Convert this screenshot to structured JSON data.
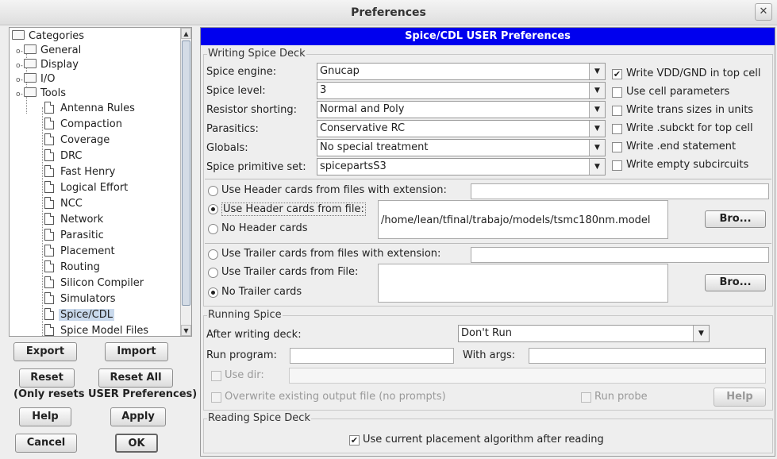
{
  "window": {
    "title": "Preferences",
    "close": "✕"
  },
  "tree": {
    "root": "Categories",
    "groups": [
      {
        "label": "General"
      },
      {
        "label": "Display"
      },
      {
        "label": "I/O"
      },
      {
        "label": "Tools"
      }
    ],
    "items": [
      "Antenna Rules",
      "Compaction",
      "Coverage",
      "DRC",
      "Fast Henry",
      "Logical Effort",
      "NCC",
      "Network",
      "Parasitic",
      "Placement",
      "Routing",
      "Silicon Compiler",
      "Simulators",
      "Spice/CDL",
      "Spice Model Files"
    ],
    "selected": "Spice/CDL"
  },
  "left_buttons": {
    "export": "Export",
    "import": "Import",
    "reset": "Reset",
    "reset_all": "Reset All",
    "reset_note": "(Only resets USER Preferences)",
    "help": "Help",
    "apply": "Apply",
    "cancel": "Cancel",
    "ok": "OK"
  },
  "panel": {
    "title": "Spice/CDL USER Preferences",
    "writing": {
      "title": "Writing Spice Deck",
      "engine_label": "Spice engine:",
      "engine_value": "Gnucap",
      "level_label": "Spice level:",
      "level_value": "3",
      "resistor_label": "Resistor shorting:",
      "resistor_value": "Normal and Poly",
      "parasitics_label": "Parasitics:",
      "parasitics_value": "Conservative RC",
      "globals_label": "Globals:",
      "globals_value": "No special treatment",
      "primitive_label": "Spice primitive set:",
      "primitive_value": "spicepartsS3",
      "checks": [
        {
          "label": "Write VDD/GND in top cell",
          "checked": true
        },
        {
          "label": "Use cell parameters",
          "checked": false
        },
        {
          "label": "Write trans sizes in units",
          "checked": false
        },
        {
          "label": "Write .subckt for top cell",
          "checked": false
        },
        {
          "label": "Write .end statement",
          "checked": false
        },
        {
          "label": "Write empty subcircuits",
          "checked": false
        }
      ],
      "header_ext_label": "Use Header cards from files with extension:",
      "header_file_label": "Use Header cards from file:",
      "header_file_value": "/home/lean/tfinal/trabajo/models/tsmc180nm.model",
      "no_header_label": "No Header cards",
      "browse1": "Bro...",
      "trailer_ext_label": "Use Trailer cards from files with extension:",
      "trailer_file_label": "Use Trailer cards from File:",
      "no_trailer_label": "No Trailer cards",
      "browse2": "Bro..."
    },
    "running": {
      "title": "Running Spice",
      "after_label": "After writing deck:",
      "after_value": "Don't Run",
      "run_program_label": "Run program:",
      "with_args_label": "With args:",
      "use_dir_label": "Use dir:",
      "overwrite_label": "Overwrite existing output file (no prompts)",
      "run_probe_label": "Run probe",
      "help": "Help"
    },
    "reading": {
      "title": "Reading Spice Deck",
      "placement_label": "Use current placement algorithm after reading",
      "placement_checked": true
    }
  }
}
